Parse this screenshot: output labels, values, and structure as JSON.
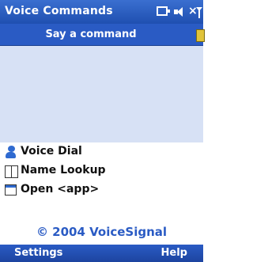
{
  "titlebar": {
    "title": "Voice Commands"
  },
  "status": {
    "icons": [
      "battery-icon",
      "speaker-icon",
      "close-x-icon",
      "signal-icon"
    ]
  },
  "prompt": {
    "text": "Say a command",
    "icon": "microphone-icon"
  },
  "commands": [
    {
      "label": "Voice Dial",
      "icon": "person-icon"
    },
    {
      "label": "Name Lookup",
      "icon": "book-icon"
    },
    {
      "label": "Open <app>",
      "icon": "window-icon"
    }
  ],
  "copyright": "© 2004 VoiceSignal",
  "softkeys": {
    "left": "Settings",
    "right": "Help"
  },
  "colors": {
    "titlebar": "#2f62c9",
    "listening_area": "#d7e1f5",
    "copyright_text": "#2a5bc4"
  }
}
